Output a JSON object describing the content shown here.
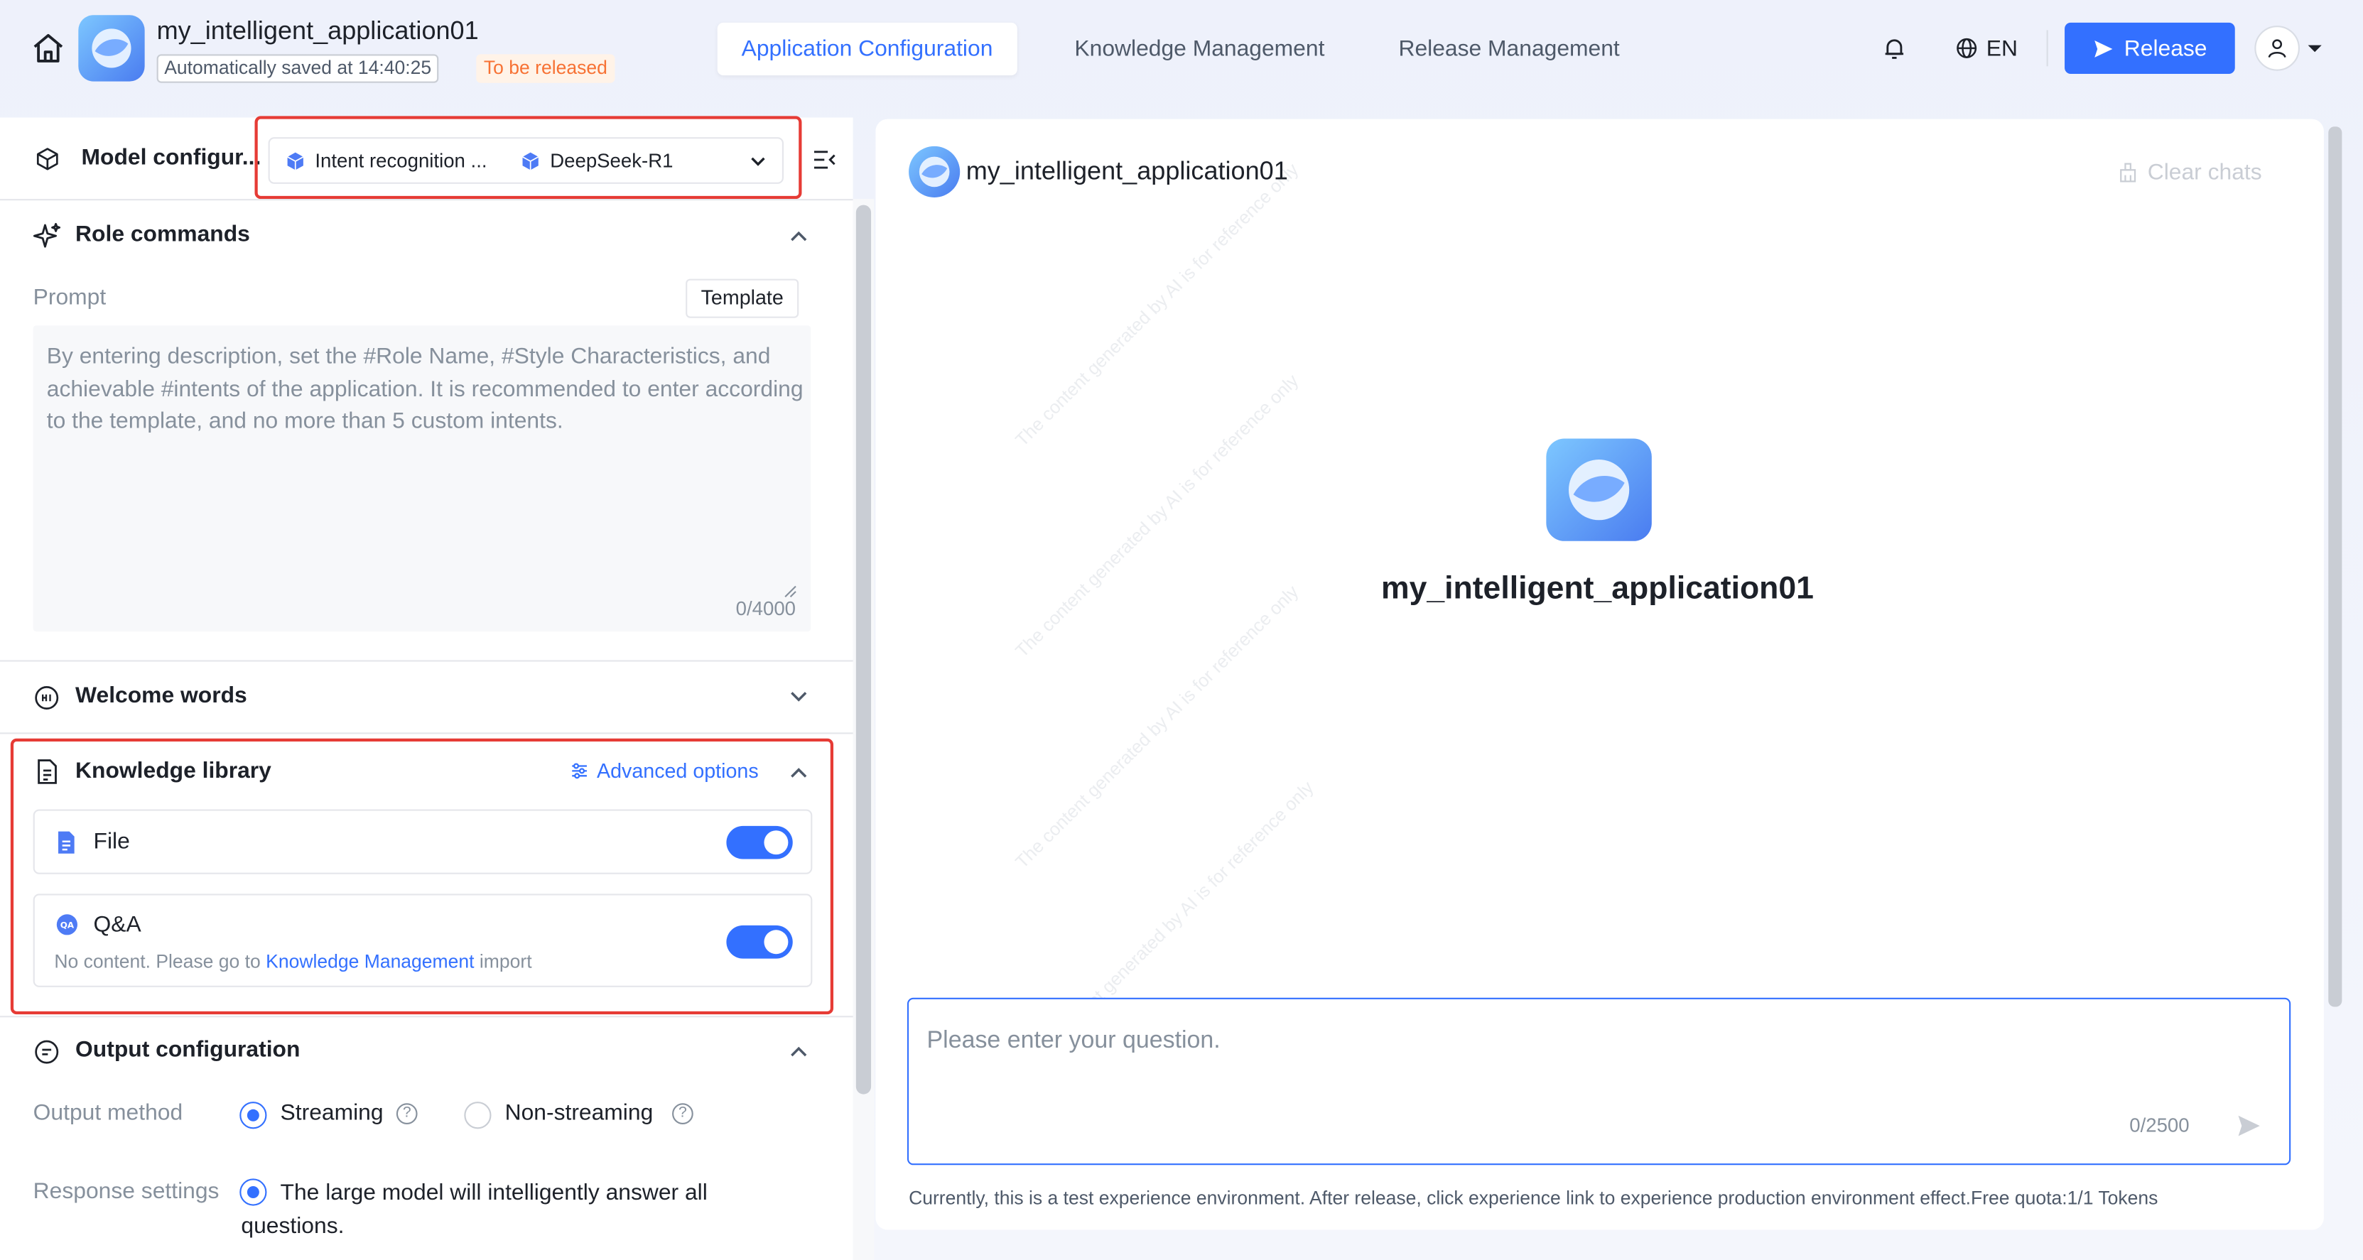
{
  "header": {
    "app_name": "my_intelligent_application01",
    "saved_text": "Automatically saved at 14:40:25",
    "status_badge": "To be released",
    "tabs": [
      {
        "label": "Application Configuration",
        "active": true
      },
      {
        "label": "Knowledge Management",
        "active": false
      },
      {
        "label": "Release Management",
        "active": false
      }
    ],
    "language": "EN",
    "release_label": "Release"
  },
  "model_config": {
    "label": "Model configur...",
    "intent_label": "Intent recognition ...",
    "model_label": "DeepSeek-R1"
  },
  "role_commands": {
    "title": "Role commands",
    "prompt_label": "Prompt",
    "template_label": "Template",
    "placeholder": "By entering description, set the #Role Name, #Style Characteristics, and achievable #intents of the application. It is recommended to enter according to the template, and no more than 5 custom intents.",
    "count": "0/4000"
  },
  "welcome_words": {
    "title": "Welcome words"
  },
  "knowledge_library": {
    "title": "Knowledge library",
    "advanced_options": "Advanced options",
    "file": {
      "label": "File",
      "enabled": true
    },
    "qa": {
      "label": "Q&A",
      "enabled": true,
      "note_prefix": "No content. Please go to",
      "note_link": "Knowledge Management",
      "note_suffix": "import"
    }
  },
  "output_config": {
    "title": "Output configuration",
    "output_method_label": "Output method",
    "streaming_label": "Streaming",
    "non_streaming_label": "Non-streaming",
    "selected_method": "Streaming",
    "response_settings_label": "Response settings",
    "response_option": "The large model will intelligently answer all questions."
  },
  "chat": {
    "app_name": "my_intelligent_application01",
    "clear_chats": "Clear chats",
    "center_name": "my_intelligent_application01",
    "input_placeholder": "Please enter your question.",
    "input_count": "0/2500",
    "footer_note": "Currently, this is a test experience environment. After release, click experience link to experience production environment effect.Free quota:1/1 Tokens",
    "watermark": "The content generated by AI is for reference only"
  },
  "colors": {
    "accent": "#3370ff",
    "highlight_border": "#e63b35",
    "status_orange": "#f77234"
  },
  "icons": {
    "home": "home-icon",
    "bell": "bell-icon",
    "globe": "globe-icon",
    "send": "send-icon",
    "user": "user-icon",
    "cube": "cube-icon",
    "sparkle": "sparkle-icon",
    "document": "document-icon",
    "message": "message-icon",
    "collapse": "collapse-panel-icon"
  }
}
